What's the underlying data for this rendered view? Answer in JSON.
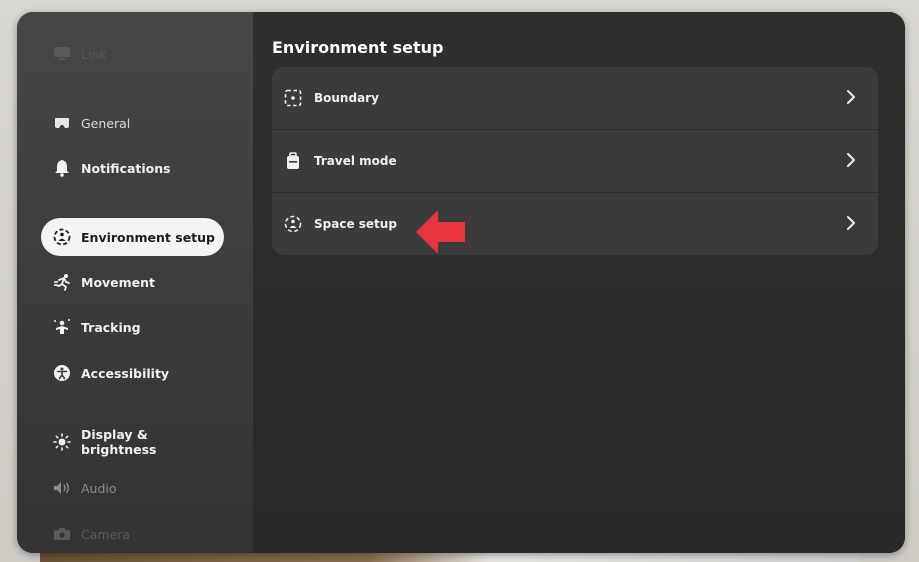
{
  "sidebar": {
    "items": [
      {
        "label": "Link",
        "icon": "link-monitor-icon"
      },
      {
        "label": "General",
        "icon": "headset-icon"
      },
      {
        "label": "Notifications",
        "icon": "bell-icon"
      },
      {
        "label": "Environment setup",
        "icon": "environment-setup-icon",
        "active": true
      },
      {
        "label": "Movement",
        "icon": "running-person-icon"
      },
      {
        "label": "Tracking",
        "icon": "tracking-person-icon"
      },
      {
        "label": "Accessibility",
        "icon": "accessibility-icon"
      },
      {
        "label": "Display & brightness",
        "icon": "brightness-icon"
      },
      {
        "label": "Audio",
        "icon": "speaker-icon"
      },
      {
        "label": "Camera",
        "icon": "camera-icon"
      }
    ]
  },
  "main": {
    "title": "Environment setup",
    "rows": [
      {
        "label": "Boundary",
        "icon": "boundary-icon"
      },
      {
        "label": "Travel mode",
        "icon": "luggage-icon"
      },
      {
        "label": "Space setup",
        "icon": "space-setup-icon"
      }
    ]
  },
  "annotation": {
    "color": "#e8343d",
    "icon": "red-arrow-pointer"
  },
  "colors": {
    "active_bg": "#f4f4f4",
    "window_bg": "#2b2b2b",
    "row_bg": "#3b3b3b"
  }
}
